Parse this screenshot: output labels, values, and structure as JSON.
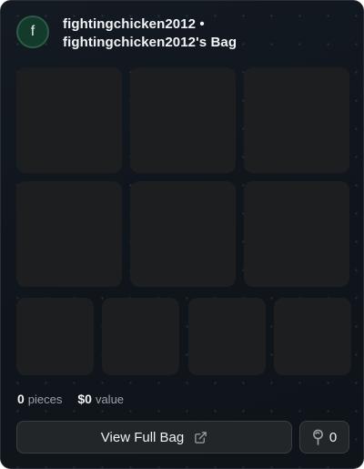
{
  "bag": {
    "avatar_initial": "f",
    "title": "fightingchicken2012 • fightingchicken2012's Bag"
  },
  "stats": {
    "pieces_count": "0",
    "pieces_label": "pieces",
    "value_amount": "$0",
    "value_label": "value"
  },
  "actions": {
    "view_full_bag_label": "View Full Bag",
    "like_count": "0"
  },
  "icons": {
    "external_link": "external-link-icon",
    "like": "lollipop-icon"
  },
  "colors": {
    "card_background": "#131820",
    "slot_background": "#1d1e1f",
    "avatar_background": "#143a2c",
    "button_background": "#232628"
  }
}
